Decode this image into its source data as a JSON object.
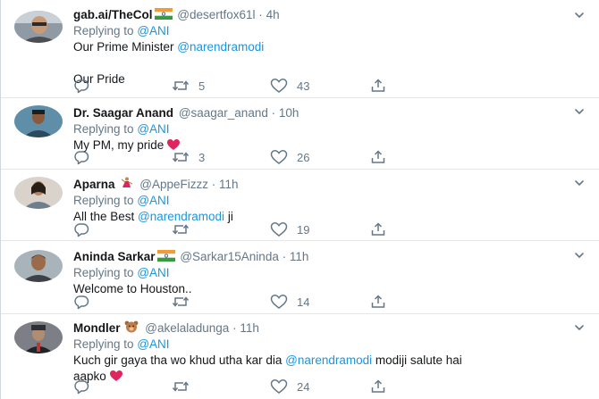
{
  "tweets": [
    {
      "name": "gab.ai/TheCol",
      "name_emoji": "india-flag-emoji",
      "handle": "@desertfox61l",
      "dot": "·",
      "time": "4h",
      "replying_label": "Replying to",
      "replying_to": "@ANI",
      "lines": [
        {
          "text": "Our Prime Minister ",
          "mention": "@narendramodi"
        },
        {
          "text": "",
          "mention": ""
        },
        {
          "text": "Our Pride",
          "mention": ""
        }
      ],
      "retweets": "5",
      "likes": "43"
    },
    {
      "name": "Dr. Saagar Anand",
      "handle": "@saagar_anand",
      "dot": "·",
      "time": "10h",
      "replying_label": "Replying to",
      "replying_to": "@ANI",
      "text": "My PM, my pride",
      "retweets": "3",
      "likes": "26"
    },
    {
      "name": "Aparna",
      "name_emoji": "dancer-emoji",
      "handle": "@AppeFizzz",
      "dot": "·",
      "time": "11h",
      "replying_label": "Replying to",
      "replying_to": "@ANI",
      "text_before": "All the Best ",
      "mention": "@narendramodi",
      "text_after": " ji",
      "retweets": "",
      "likes": "19"
    },
    {
      "name": "Aninda Sarkar",
      "name_emoji": "india-flag-emoji",
      "handle": "@Sarkar15Aninda",
      "dot": "·",
      "time": "11h",
      "replying_label": "Replying to",
      "replying_to": "@ANI",
      "text": "Welcome to Houston..",
      "retweets": "",
      "likes": "14"
    },
    {
      "name": "Mondler",
      "name_emoji": "bear-emoji",
      "handle": "@akelaladunga",
      "dot": "·",
      "time": "11h",
      "replying_label": "Replying to",
      "replying_to": "@ANI",
      "text_before": "Kuch gir gaya tha wo khud utha kar dia ",
      "mention": "@narendramodi",
      "text_after": " modiji salute hai",
      "text_line2": "aapko",
      "retweets": "",
      "likes": "24"
    }
  ],
  "colors": {
    "link": "#1b95e0",
    "muted": "#657786",
    "heart_emoji": "#e0245e"
  },
  "icons": [
    "reply-icon",
    "retweet-icon",
    "like-icon",
    "share-icon",
    "chevron-down-icon"
  ]
}
